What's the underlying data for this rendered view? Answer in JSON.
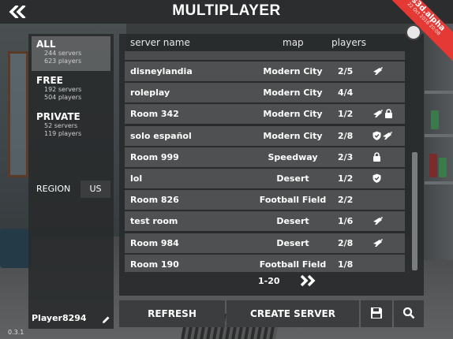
{
  "header": {
    "title": "MULTIPLAYER",
    "ribbon_version": "s3d.alpha",
    "ribbon_date": "22 Oct 2016 20:08"
  },
  "filters": [
    {
      "label": "ALL",
      "servers": "244 servers",
      "players": "623 players"
    },
    {
      "label": "FREE",
      "servers": "192 servers",
      "players": "504 players"
    },
    {
      "label": "PRIVATE",
      "servers": "52 servers",
      "players": "119 players"
    }
  ],
  "region": {
    "label": "REGION",
    "value": "US"
  },
  "player": {
    "name": "Player8294"
  },
  "app_version": "0.3.1",
  "list": {
    "columns": {
      "name": "server name",
      "map": "map",
      "players": "players"
    },
    "rows": [
      {
        "name": "disneylandia",
        "map": "Modern City",
        "players": "2/5",
        "icons": [
          "gun"
        ]
      },
      {
        "name": "roleplay",
        "map": "Modern City",
        "players": "4/4",
        "icons": []
      },
      {
        "name": "Room 342",
        "map": "Modern City",
        "players": "1/2",
        "icons": [
          "gun",
          "lock"
        ]
      },
      {
        "name": "solo español",
        "map": "Modern City",
        "players": "2/8",
        "icons": [
          "shield",
          "gun"
        ]
      },
      {
        "name": "Room 999",
        "map": "Speedway",
        "players": "2/3",
        "icons": [
          "lock"
        ]
      },
      {
        "name": "lol",
        "map": "Desert",
        "players": "1/2",
        "icons": [
          "shield"
        ]
      },
      {
        "name": "Room 826",
        "map": "Football Field",
        "players": "2/2",
        "icons": []
      },
      {
        "name": "test room",
        "map": "Desert",
        "players": "1/6",
        "icons": [
          "gun"
        ]
      },
      {
        "name": "Room 984",
        "map": "Desert",
        "players": "2/8",
        "icons": [
          "gun"
        ]
      },
      {
        "name": "Room 190",
        "map": "Football Field",
        "players": "1/8",
        "icons": []
      }
    ],
    "page": "1-20"
  },
  "buttons": {
    "refresh": "REFRESH",
    "create": "CREATE SERVER"
  },
  "colors": {
    "ribbon": "#e53935",
    "panel": "#282a2b",
    "row": "#4e5051"
  }
}
